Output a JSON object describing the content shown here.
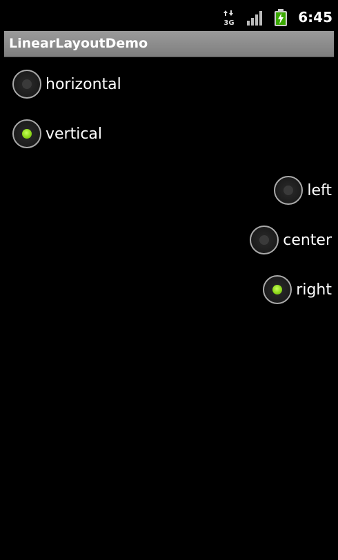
{
  "status_bar": {
    "network": "3G",
    "signal_icon": "signal-bars-icon",
    "battery_icon": "battery-charging-icon",
    "time": "6:45"
  },
  "app": {
    "title": "LinearLayoutDemo"
  },
  "orientation_group": {
    "options": [
      {
        "label": "horizontal",
        "checked": false
      },
      {
        "label": "vertical",
        "checked": true
      }
    ]
  },
  "gravity_group": {
    "options": [
      {
        "label": "left",
        "checked": false
      },
      {
        "label": "center",
        "checked": false
      },
      {
        "label": "right",
        "checked": true
      }
    ]
  },
  "colors": {
    "checked_dot": "#8ed81a",
    "background": "#000000",
    "title_bar": "#8a8a8a"
  }
}
